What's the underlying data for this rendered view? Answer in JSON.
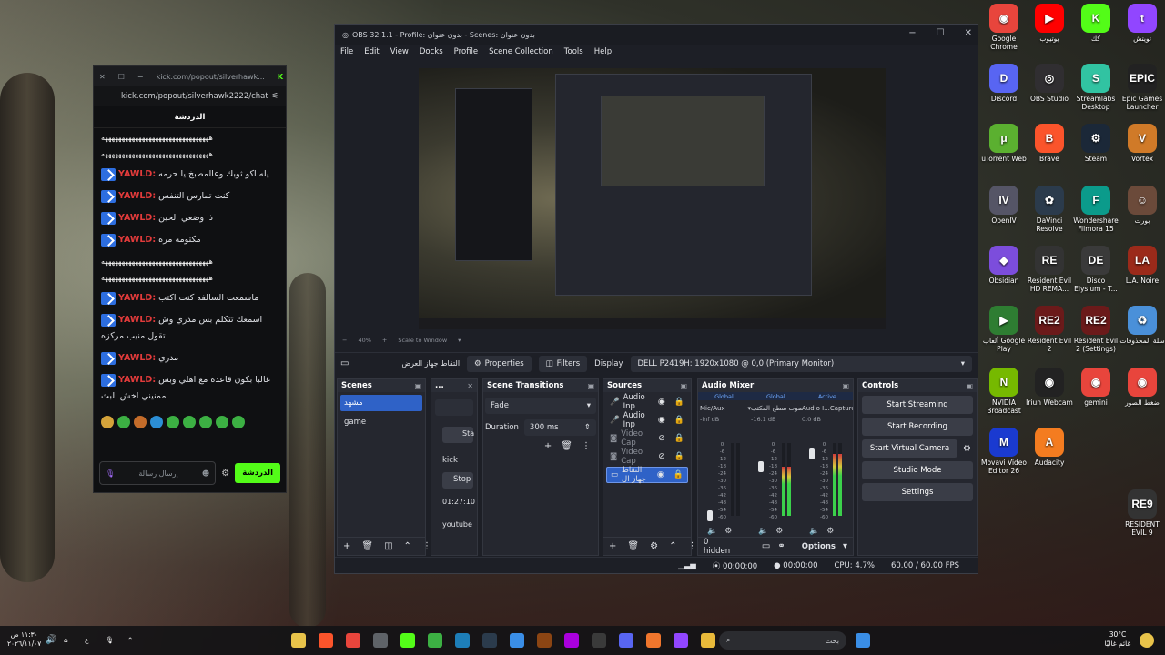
{
  "desktop_icons": [
    {
      "label": "Google Chrome",
      "color": "#e8453c",
      "glyph": "◉"
    },
    {
      "label": "يوتيوب",
      "color": "#ff0000",
      "glyph": "▶"
    },
    {
      "label": "كك",
      "color": "#53fc18",
      "glyph": "K"
    },
    {
      "label": "تويتش",
      "color": "#9146ff",
      "glyph": "t"
    },
    {
      "label": "Discord",
      "color": "#5865f2",
      "glyph": "D"
    },
    {
      "label": "OBS Studio",
      "color": "#302e31",
      "glyph": "◎"
    },
    {
      "label": "Streamlabs Desktop",
      "color": "#31c3a2",
      "glyph": "S"
    },
    {
      "label": "Epic Games Launcher",
      "color": "#222",
      "glyph": "EPIC"
    },
    {
      "label": "uTorrent Web",
      "color": "#5bb030",
      "glyph": "μ"
    },
    {
      "label": "Brave",
      "color": "#fb542b",
      "glyph": "B"
    },
    {
      "label": "Steam",
      "color": "#1b2838",
      "glyph": "⚙"
    },
    {
      "label": "Vortex",
      "color": "#d07a28",
      "glyph": "V"
    },
    {
      "label": "OpenIV",
      "color": "#556",
      "glyph": "IV"
    },
    {
      "label": "DaVinci Resolve",
      "color": "#2b3b4c",
      "glyph": "✿"
    },
    {
      "label": "Wondershare Filmora 15",
      "color": "#0b9b8b",
      "glyph": "F"
    },
    {
      "label": "بورت",
      "color": "#6b4a3a",
      "glyph": "☺"
    },
    {
      "label": "Obsidian",
      "color": "#7c4ddc",
      "glyph": "◆"
    },
    {
      "label": "Resident Evil HD REMA...",
      "color": "#333",
      "glyph": "RE"
    },
    {
      "label": "Disco Elysium - T...",
      "color": "#3a3a3a",
      "glyph": "DE"
    },
    {
      "label": "L.A. Noire",
      "color": "#9b2a1a",
      "glyph": "LA"
    },
    {
      "label": "ألعاب Google Play",
      "color": "#2e7d32",
      "glyph": "▶"
    },
    {
      "label": "Resident Evil 2",
      "color": "#6b1a1a",
      "glyph": "RE2"
    },
    {
      "label": "Resident Evil 2 (Settings)",
      "color": "#6b1a1a",
      "glyph": "RE2"
    },
    {
      "label": "سلة المحذوفات",
      "color": "#4a90d9",
      "glyph": "♻"
    },
    {
      "label": "NVIDIA Broadcast",
      "color": "#76b900",
      "glyph": "N"
    },
    {
      "label": "Iriun Webcam",
      "color": "#222",
      "glyph": "◉"
    },
    {
      "label": "gemini",
      "color": "#e8453c",
      "glyph": "◉"
    },
    {
      "label": "ضغط الصور",
      "color": "#e8453c",
      "glyph": "◉"
    },
    {
      "label": "Movavi Video Editor 26",
      "color": "#1a3ad0",
      "glyph": "M"
    },
    {
      "label": "Audacity",
      "color": "#f47c20",
      "glyph": "A"
    },
    {
      "label": "RESIDENT EVIL 9",
      "color": "#333",
      "glyph": "RE9"
    }
  ],
  "chat": {
    "tab_title": "kick.com/popout/silverhawk...",
    "url": "kick.com/popout/silverhawk2222/chat",
    "header": "الدردشة",
    "separator": "ههههههههههههههههههههههههههههههههه",
    "messages": [
      {
        "user": "YAWLD:",
        "text": "يله اكو ثوبك وعالمطبخ يا حرمه"
      },
      {
        "user": "YAWLD:",
        "text": "كنت تمارس التنفس"
      },
      {
        "user": "YAWLD:",
        "text": "ذا وضعي الحين"
      },
      {
        "user": "YAWLD:",
        "text": "مكتومه مره"
      },
      {
        "user": "YAWLD:",
        "text": "ماسمعت السالفه كنت اكتب"
      },
      {
        "user": "YAWLD:",
        "text": "اسمعك تتكلم بس مدري وش تقول منيب مركزه"
      },
      {
        "user": "YAWLD:",
        "text": "مدري"
      },
      {
        "user": "YAWLD:",
        "text": "غالبا بكون قاعده مع اهلي وبس ممنيني اخش البث"
      }
    ],
    "input_placeholder": "إرسال رسالة",
    "send_label": "الدردشة"
  },
  "obs": {
    "title": "OBS 32.1.1 - Profile: بدون عنوان - Scenes: بدون عنوان",
    "menu": [
      "File",
      "Edit",
      "View",
      "Docks",
      "Profile",
      "Scene Collection",
      "Tools",
      "Help"
    ],
    "zoom": "40%",
    "zoom_mode": "Scale to Window",
    "toolbar": {
      "source_label": "التقاط جهاز العرض",
      "properties": "Properties",
      "filters": "Filters",
      "display_label": "Display",
      "display_value": "DELL P2419H: 1920x1080 @ 0,0 (Primary Monitor)"
    },
    "scenes": {
      "title": "Scenes",
      "items": [
        "مشهد",
        "game"
      ]
    },
    "hidden_dock": {
      "items": [
        "Sta",
        "kick",
        "Stop",
        "01:27:10",
        "youtube"
      ]
    },
    "transitions": {
      "title": "Scene Transitions",
      "type": "Fade",
      "duration_label": "Duration",
      "duration_value": "300 ms"
    },
    "sources": {
      "title": "Sources",
      "items": [
        "Audio Inp",
        "Audio Inp",
        "Video Cap",
        "Video Cap",
        "التقاط جهاز ال"
      ]
    },
    "mixer": {
      "title": "Audio Mixer",
      "tabs": [
        "Global",
        "Global",
        "Active"
      ],
      "channels": [
        {
          "name": "Mic/Aux",
          "db": "-inf dB",
          "level": 0.0
        },
        {
          "name": "صوت سطح المكتب",
          "db": "-16.1 dB",
          "level": 0.68
        },
        {
          "name": "Audio I...Capture",
          "db": "0.0 dB",
          "level": 0.85
        }
      ],
      "scale": [
        "0",
        "-6",
        "-12",
        "-18",
        "-24",
        "-30",
        "-36",
        "-42",
        "-48",
        "-54",
        "-60"
      ],
      "hidden_count": "0 hidden",
      "options": "Options"
    },
    "controls": {
      "title": "Controls",
      "buttons": [
        "Start Streaming",
        "Start Recording",
        "Start Virtual Camera",
        "Studio Mode",
        "Settings"
      ]
    },
    "status": {
      "time1": "00:00:00",
      "time2": "00:00:00",
      "cpu": "CPU: 4.7%",
      "fps": "60.00 / 60.00 FPS"
    }
  },
  "taskbar": {
    "time": "١١:٣٠ ص",
    "date": "٢٠٢٦/١١/٠٧",
    "lang": "ع",
    "search_placeholder": "بحث",
    "weather_temp": "30°C",
    "weather_desc": "غائم غالبًا"
  }
}
